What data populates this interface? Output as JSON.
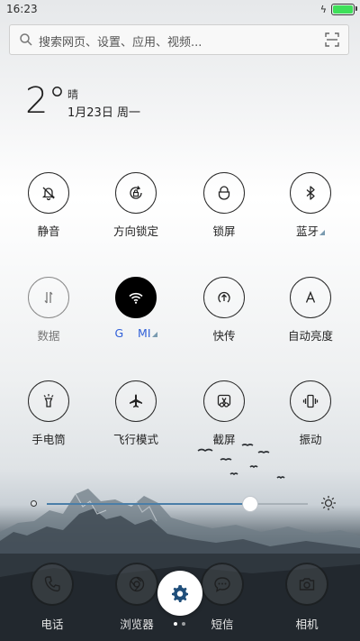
{
  "status_bar": {
    "time": "16:23",
    "battery_level": 1.0
  },
  "search": {
    "placeholder": "搜索网页、设置、应用、视频..."
  },
  "weather": {
    "temperature": "2°",
    "condition": "晴",
    "date": "1月23日 周一"
  },
  "toggles": [
    {
      "label": "静音",
      "icon": "bell-off-icon",
      "state": "off"
    },
    {
      "label": "方向锁定",
      "icon": "rotation-lock-icon",
      "state": "off"
    },
    {
      "label": "锁屏",
      "icon": "lock-icon",
      "state": "off"
    },
    {
      "label": "蓝牙",
      "icon": "bluetooth-icon",
      "state": "off"
    },
    {
      "label": "数据",
      "icon": "mobile-data-icon",
      "state": "disabled"
    },
    {
      "label": "G    MI",
      "icon": "wifi-icon",
      "state": "on"
    },
    {
      "label": "快传",
      "icon": "quick-transfer-icon",
      "state": "off"
    },
    {
      "label": "自动亮度",
      "icon": "auto-brightness-icon",
      "state": "off"
    },
    {
      "label": "手电筒",
      "icon": "flashlight-icon",
      "state": "off"
    },
    {
      "label": "飞行模式",
      "icon": "airplane-icon",
      "state": "off"
    },
    {
      "label": "截屏",
      "icon": "screenshot-icon",
      "state": "off"
    },
    {
      "label": "振动",
      "icon": "vibrate-icon",
      "state": "off"
    }
  ],
  "brightness": {
    "level": 0.78
  },
  "dock": {
    "apps": [
      {
        "label": "电话",
        "icon": "phone-icon"
      },
      {
        "label": "浏览器",
        "icon": "browser-icon"
      },
      {
        "label": "短信",
        "icon": "messages-icon"
      },
      {
        "label": "相机",
        "icon": "camera-icon"
      }
    ],
    "settings_icon": "gear-icon",
    "pages": 2,
    "current_page": 1
  },
  "colors": {
    "accent": "#4a7ea8",
    "wifi_label": "#2f5fd8",
    "battery": "#3ee05a"
  }
}
